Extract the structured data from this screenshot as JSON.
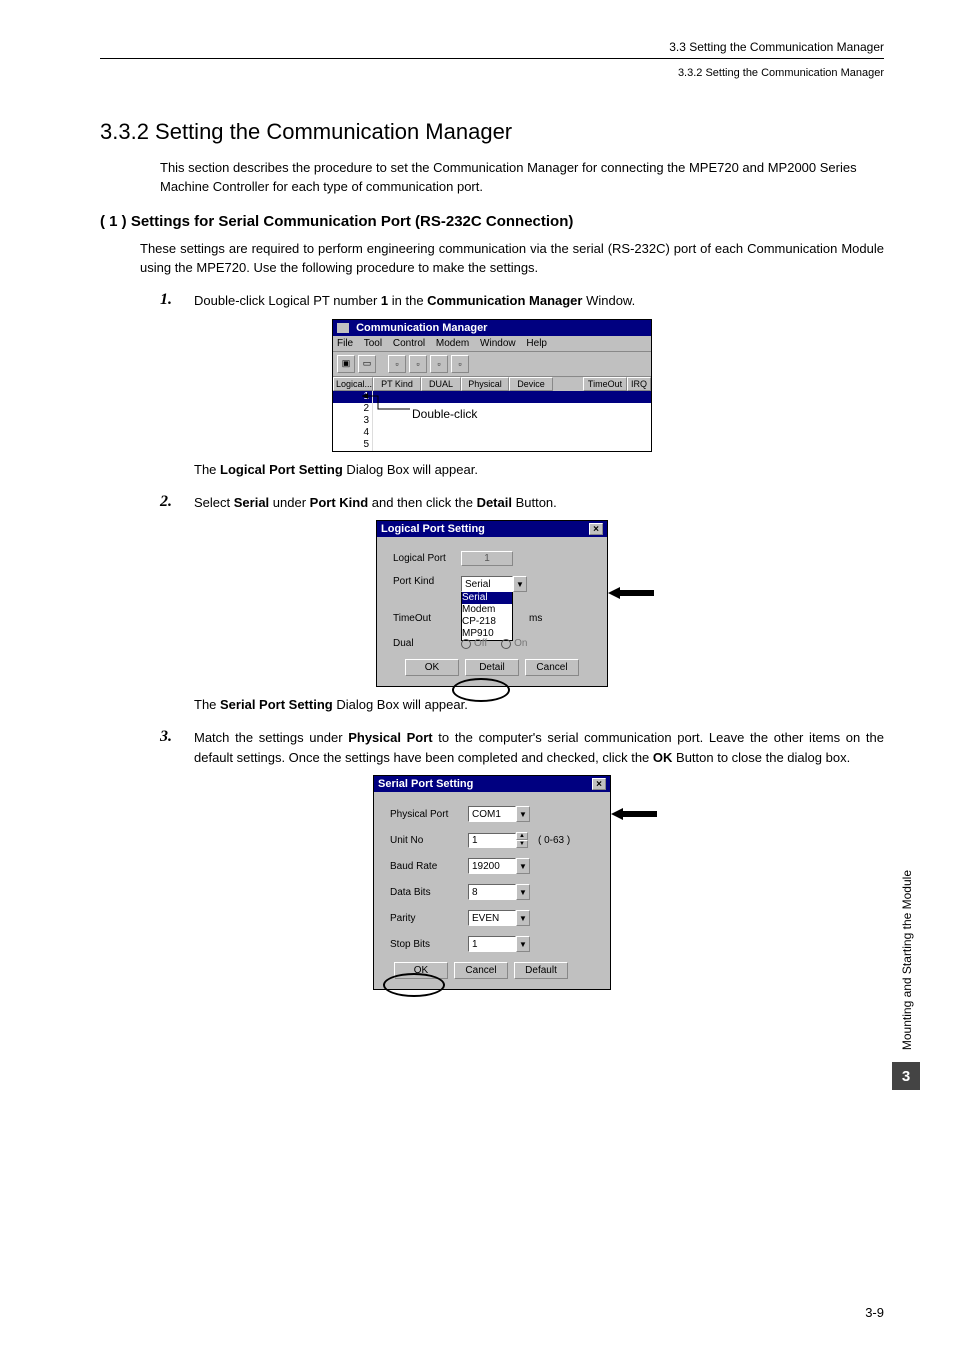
{
  "header": {
    "right1": "3.3  Setting the Communication Manager",
    "right2": "3.3.2  Setting the Communication Manager"
  },
  "section": {
    "num_title": "3.3.2  Setting the Communication Manager",
    "intro": "This section describes the procedure to set the Communication Manager for connecting the MPE720 and MP2000 Series Machine Controller for each type of communication port."
  },
  "sub1": {
    "head": "( 1 )  Settings for Serial Communication Port (RS-232C Connection)",
    "intro": "These settings are required to perform engineering communication via the serial (RS-232C) port of each Communication Module using the MPE720. Use the following procedure to make the settings."
  },
  "step1": {
    "num": "1.",
    "pre": "Double-click Logical PT number ",
    "bold1": "1",
    "mid": " in the ",
    "bold2": "Communication Manager",
    "suf": " Window."
  },
  "step1_after": {
    "pre": "The ",
    "bold": "Logical Port Setting",
    "suf": " Dialog Box will appear."
  },
  "step2": {
    "num": "2.",
    "pre": "Select ",
    "b1": "Serial",
    "mid1": " under ",
    "b2": "Port Kind",
    "mid2": " and then click the ",
    "b3": "Detail",
    "suf": " Button."
  },
  "step2_after": {
    "pre": "The ",
    "bold": "Serial Port Setting",
    "suf": " Dialog Box will appear."
  },
  "step3": {
    "num": "3.",
    "pre": "Match the settings under ",
    "b1": "Physical Port",
    "mid1": " to the computer's serial communication port. Leave the other items on the default settings. Once the settings have been completed and checked, click the ",
    "b2": "OK",
    "suf": " Button to close the dialog box."
  },
  "cm": {
    "title": "Communication Manager",
    "menu": [
      "File",
      "Tool",
      "Control",
      "Modem",
      "Window",
      "Help"
    ],
    "cols": [
      "Logical...",
      "PT Kind",
      "DUAL",
      "Physical",
      "Device",
      "TimeOut",
      "IRQ"
    ],
    "rows": [
      "1",
      "2",
      "3",
      "4",
      "5"
    ],
    "dblclick": "Double-click"
  },
  "lps": {
    "title": "Logical Port Setting",
    "labels": {
      "logical_port": "Logical Port",
      "port_kind": "Port Kind",
      "timeout": "TimeOut",
      "dual": "Dual",
      "ms": "ms",
      "off": "Off",
      "on": "On"
    },
    "values": {
      "logical_port": "1",
      "port_kind": "Serial",
      "options": [
        "Serial",
        "Modem",
        "CP-218",
        "MP910"
      ]
    },
    "buttons": {
      "ok": "OK",
      "detail": "Detail",
      "cancel": "Cancel"
    }
  },
  "sps": {
    "title": "Serial Port Setting",
    "labels": {
      "physical_port": "Physical Port",
      "unit_no": "Unit No",
      "baud_rate": "Baud Rate",
      "data_bits": "Data Bits",
      "parity": "Parity",
      "stop_bits": "Stop Bits",
      "range": "( 0-63 )"
    },
    "values": {
      "physical_port": "COM1",
      "unit_no": "1",
      "baud_rate": "19200",
      "data_bits": "8",
      "parity": "EVEN",
      "stop_bits": "1"
    },
    "buttons": {
      "ok": "OK",
      "cancel": "Cancel",
      "def": "Default"
    }
  },
  "side": {
    "text": "Mounting and Starting the Module",
    "chapter": "3"
  },
  "pagenum": "3-9"
}
